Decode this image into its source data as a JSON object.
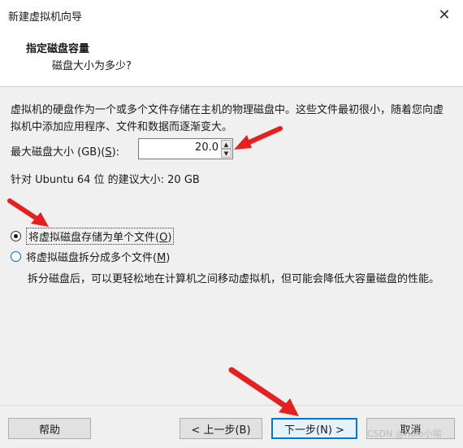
{
  "window": {
    "title": "新建虚拟机向导",
    "close_glyph": "✕"
  },
  "header": {
    "title": "指定磁盘容量",
    "subtitle": "磁盘大小为多少?"
  },
  "main": {
    "description": "虚拟机的硬盘作为一个或多个文件存储在主机的物理磁盘中。这些文件最初很小，随着您向虚拟机中添加应用程序、文件和数据而逐渐变大。",
    "size_label_prefix": "最大磁盘大小 (GB)(",
    "size_label_key": "S",
    "size_label_suffix": "):",
    "size_value": "20.0",
    "recommendation": "针对 Ubuntu 64 位 的建议大小: 20 GB",
    "options": [
      {
        "label": "将虚拟磁盘存储为单个文件(",
        "key": "O",
        "suffix": ")",
        "selected": true
      },
      {
        "label": "将虚拟磁盘拆分成多个文件(",
        "key": "M",
        "suffix": ")",
        "selected": false
      }
    ],
    "split_description": "拆分磁盘后，可以更轻松地在计算机之间移动虚拟机，但可能会降低大容量磁盘的性能。"
  },
  "footer": {
    "help": "帮助",
    "back": "< 上一步(B)",
    "next": "下一步(N) >",
    "cancel": "取消"
  },
  "watermark": "CSDN @hulo小喻",
  "colors": {
    "accent": "#0078d7",
    "arrow": "#e5201e"
  }
}
